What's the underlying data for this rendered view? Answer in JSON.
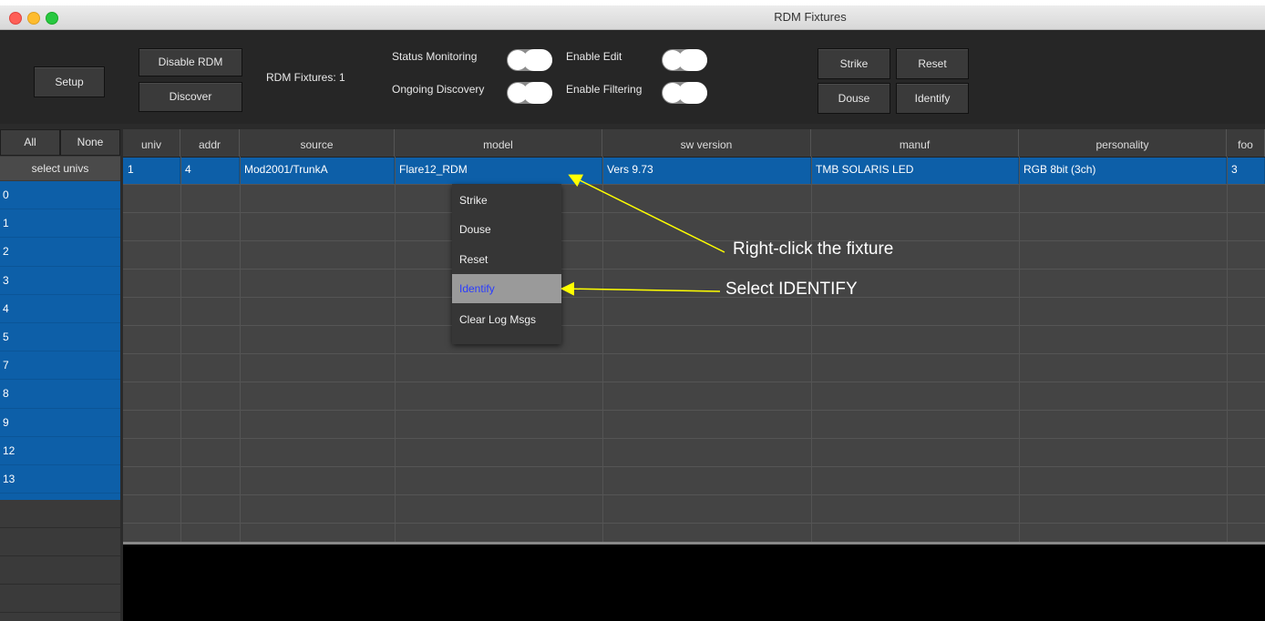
{
  "window": {
    "title": "RDM Fixtures"
  },
  "toolbar": {
    "setup": "Setup",
    "disable_rdm": "Disable RDM",
    "discover": "Discover",
    "fixture_count": "RDM Fixtures:  1",
    "status_monitoring": "Status Monitoring",
    "ongoing_discovery": "Ongoing Discovery",
    "enable_edit": "Enable Edit",
    "enable_filtering": "Enable Filtering",
    "strike": "Strike",
    "reset": "Reset",
    "douse": "Douse",
    "identify": "Identify"
  },
  "left": {
    "all": "All",
    "none": "None",
    "select_univs": "select univs",
    "univs": [
      "0",
      "1",
      "2",
      "3",
      "4",
      "5",
      "7",
      "8",
      "9",
      "12",
      "13"
    ]
  },
  "table": {
    "headers": [
      "univ",
      "addr",
      "source",
      "model",
      "sw version",
      "manuf",
      "personality",
      "foo"
    ],
    "row": [
      "1",
      "4",
      "Mod2001/TrunkA",
      "Flare12_RDM",
      "Vers 9.73",
      "TMB SOLARIS LED",
      "RGB 8bit (3ch)",
      "3"
    ]
  },
  "context_menu": {
    "items": [
      "Strike",
      "Douse",
      "Reset",
      "Identify",
      "Clear Log Msgs"
    ],
    "highlighted": "Identify"
  },
  "annotations": {
    "right_click": "Right-click the fixture",
    "select_identify": "Select IDENTIFY"
  },
  "colors": {
    "selection": "#0d5fa8",
    "arrow": "#ffff00"
  }
}
